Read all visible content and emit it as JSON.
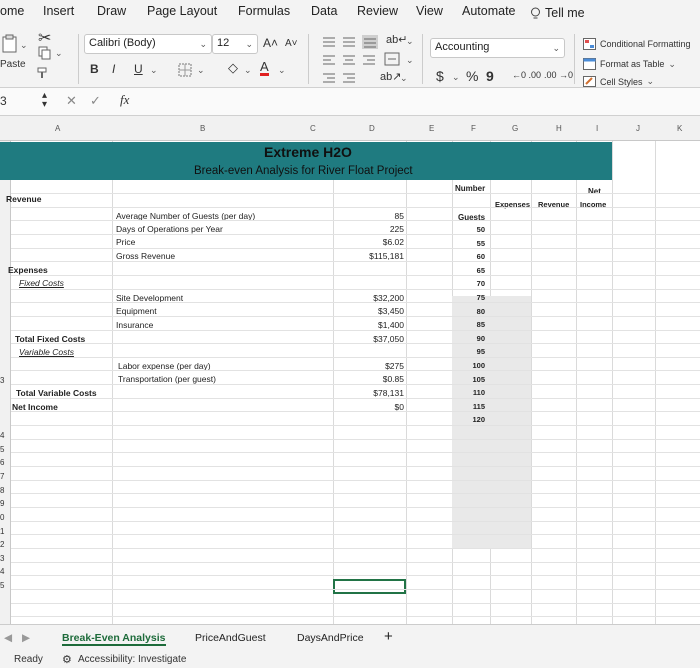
{
  "tabs": [
    "ome",
    "Insert",
    "Draw",
    "Page Layout",
    "Formulas",
    "Data",
    "Review",
    "View",
    "Automate"
  ],
  "tell_me": "Tell me",
  "ribbon": {
    "paste": "Paste",
    "font_name": "Calibri (Body)",
    "font_size": "12",
    "bold": "B",
    "italic": "I",
    "underline": "U",
    "number_format": "Accounting",
    "currency": "$",
    "percent": "%",
    "comma": "9",
    "conditional_formatting": "Conditional Formatting",
    "format_as_table": "Format as Table",
    "cell_styles": "Cell Styles"
  },
  "formula_bar": {
    "cell_ref": "3",
    "fx": "fx",
    "value": ""
  },
  "columns": [
    "A",
    "B",
    "C",
    "D",
    "E",
    "F",
    "G",
    "H",
    "I",
    "J",
    "K"
  ],
  "rows": [
    "",
    "",
    "",
    "",
    "",
    "",
    "",
    "",
    "",
    "",
    "",
    "",
    "",
    "",
    "",
    "",
    "",
    "",
    "",
    "3",
    "",
    "",
    "",
    "4",
    "5",
    "6",
    "7",
    "8",
    "9",
    "0",
    "1",
    "2",
    "3",
    "4",
    "5"
  ],
  "banner": {
    "title": "Extreme H2O",
    "subtitle": "Break-even Analysis for River Float Project"
  },
  "cells": {
    "revenue": "Revenue",
    "avg_guests_label": "Average Number of Guests (per day)",
    "days_label": "Days of Operations per Year",
    "price_label": "Price",
    "gross_label": "Gross Revenue",
    "avg_guests": "85",
    "days": "225",
    "price": "$6.02",
    "gross": "$115,181",
    "expenses": "Expenses",
    "fixed_costs": "Fixed Costs",
    "site_label": "Site Development",
    "equip_label": "Equipment",
    "ins_label": "Insurance",
    "site": "$32,200",
    "equip": "$3,450",
    "ins": "$1,400",
    "fixed_total": "$37,050",
    "total_fixed": "Total Fixed Costs",
    "variable_costs": "Variable Costs",
    "labor_label": "Labor expense (per day)",
    "transport_label": "Transportation (per guest)",
    "labor": "$275",
    "transport": "$0.85",
    "variable_total": "$78,131",
    "net_income_value": "$0",
    "total_variable": "Total Variable Costs",
    "net_income": "Net Income"
  },
  "table": {
    "number_header": "Number",
    "net_header": "Net",
    "expenses_header": "Expenses",
    "revenue_header": "Revenue",
    "income_header": "Income",
    "guests_header": "Guests",
    "guests": [
      "50",
      "55",
      "60",
      "65",
      "70",
      "75",
      "80",
      "85",
      "90",
      "95",
      "100",
      "105",
      "110",
      "115",
      "120"
    ]
  },
  "sheets": [
    "Break-Even Analysis",
    "PriceAndGuest",
    "DaysAndPrice"
  ],
  "status": {
    "ready": "Ready",
    "accessibility": "Accessibility: Investigate"
  },
  "colors": {
    "banner": "#1f7b80",
    "selection": "#217346",
    "shade": "#e9e9e9"
  }
}
